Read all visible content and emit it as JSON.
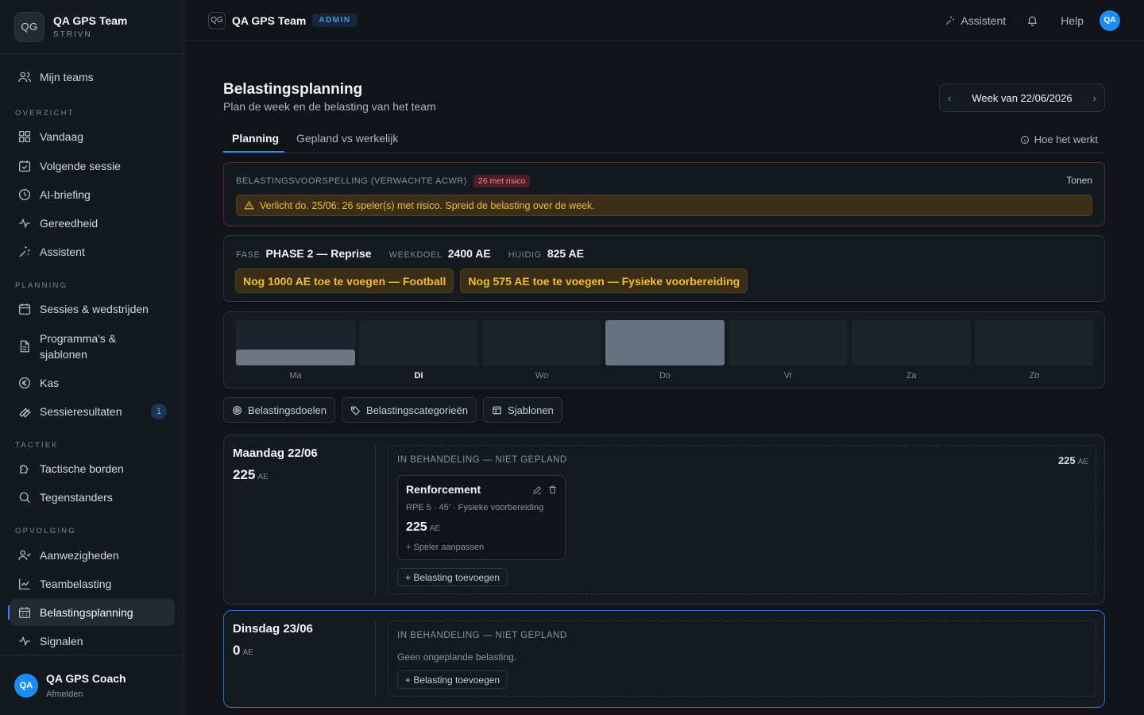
{
  "sidebar": {
    "brand_initials": "QG",
    "brand_title": "QA GPS Team",
    "brand_sub": "STRIVN",
    "my_teams": "Mijn teams",
    "sections": {
      "overview": "OVERZICHT",
      "planning": "PLANNING",
      "tactics": "TACTIEK",
      "followup": "OPVOLGING"
    },
    "items": {
      "today": "Vandaag",
      "next_session": "Volgende sessie",
      "ai_briefing": "AI-briefing",
      "readiness": "Gereedheid",
      "assistant": "Assistent",
      "sessions_matches": "Sessies & wedstrijden",
      "programs_line1": "Programma's &",
      "programs_line2": "sjablonen",
      "cash": "Kas",
      "session_results": "Sessieresultaten",
      "session_results_badge": "1",
      "tactical_boards": "Tactische borden",
      "opponents": "Tegenstanders",
      "attendance": "Aanwezigheden",
      "team_load": "Teambelasting",
      "load_planning": "Belastingsplanning",
      "signals": "Signalen"
    },
    "user": {
      "initials": "QA",
      "name": "QA GPS Coach",
      "logout": "Afmelden"
    }
  },
  "topbar": {
    "team_initials": "QG",
    "team_name": "QA GPS Team",
    "role_badge": "ADMIN",
    "assistant": "Assistent",
    "help": "Help",
    "avatar": "QA"
  },
  "page": {
    "title": "Belastingsplanning",
    "subtitle": "Plan de week en de belasting van het team",
    "week_label": "Week van 22/06/2026",
    "tabs": [
      "Planning",
      "Gepland vs werkelijk"
    ],
    "how_it_works": "Hoe het werkt"
  },
  "forecast": {
    "label": "BELASTINGSVOORSPELLING (VERWACHTE ACWR)",
    "risk_badge": "26 met risico",
    "toggle": "Tonen",
    "warning": "Verlicht do. 25/06: 26 speler(s) met risico. Spreid de belasting over de week."
  },
  "phase": {
    "phase_key": "FASE",
    "phase_value": "PHASE 2 — Reprise",
    "goal_key": "WEEKDOEL",
    "goal_value": "2400 AE",
    "current_key": "HUIDIG",
    "current_value": "825 AE",
    "pills": [
      "Nog 1000 AE toe te voegen — Football",
      "Nog 575 AE toe te voegen — Fysieke voorbereiding"
    ]
  },
  "week_chart": {
    "days": [
      {
        "label": "Ma",
        "fill": 0.35,
        "today": false
      },
      {
        "label": "Di",
        "fill": 0.0,
        "today": true
      },
      {
        "label": "Wo",
        "fill": 0.0,
        "today": false
      },
      {
        "label": "Do",
        "fill": 1.0,
        "today": false
      },
      {
        "label": "Vr",
        "fill": 0.0,
        "today": false
      },
      {
        "label": "Za",
        "fill": 0.0,
        "today": false
      },
      {
        "label": "Zo",
        "fill": 0.0,
        "today": false
      }
    ]
  },
  "toolbar": {
    "load_goals": "Belastingsdoelen",
    "load_categories": "Belastingscategorieën",
    "templates": "Sjablonen"
  },
  "days": [
    {
      "name": "Maandag 22/06",
      "total": "225",
      "unit": "AE",
      "status": "IN BEHANDELING — NIET GEPLAND",
      "status_total": "225",
      "session": {
        "title": "Renforcement",
        "meta": "RPE 5 · 45′ · Fysieke voorbereiding",
        "load": "225",
        "adjust": "+ Speler aanpassen"
      },
      "add_load": "+ Belasting toevoegen"
    },
    {
      "name": "Dinsdag 23/06",
      "total": "0",
      "unit": "AE",
      "status": "IN BEHANDELING — NIET GEPLAND",
      "empty_note": "Geen ongeplande belasting.",
      "add_load": "+ Belasting toevoegen"
    }
  ]
}
